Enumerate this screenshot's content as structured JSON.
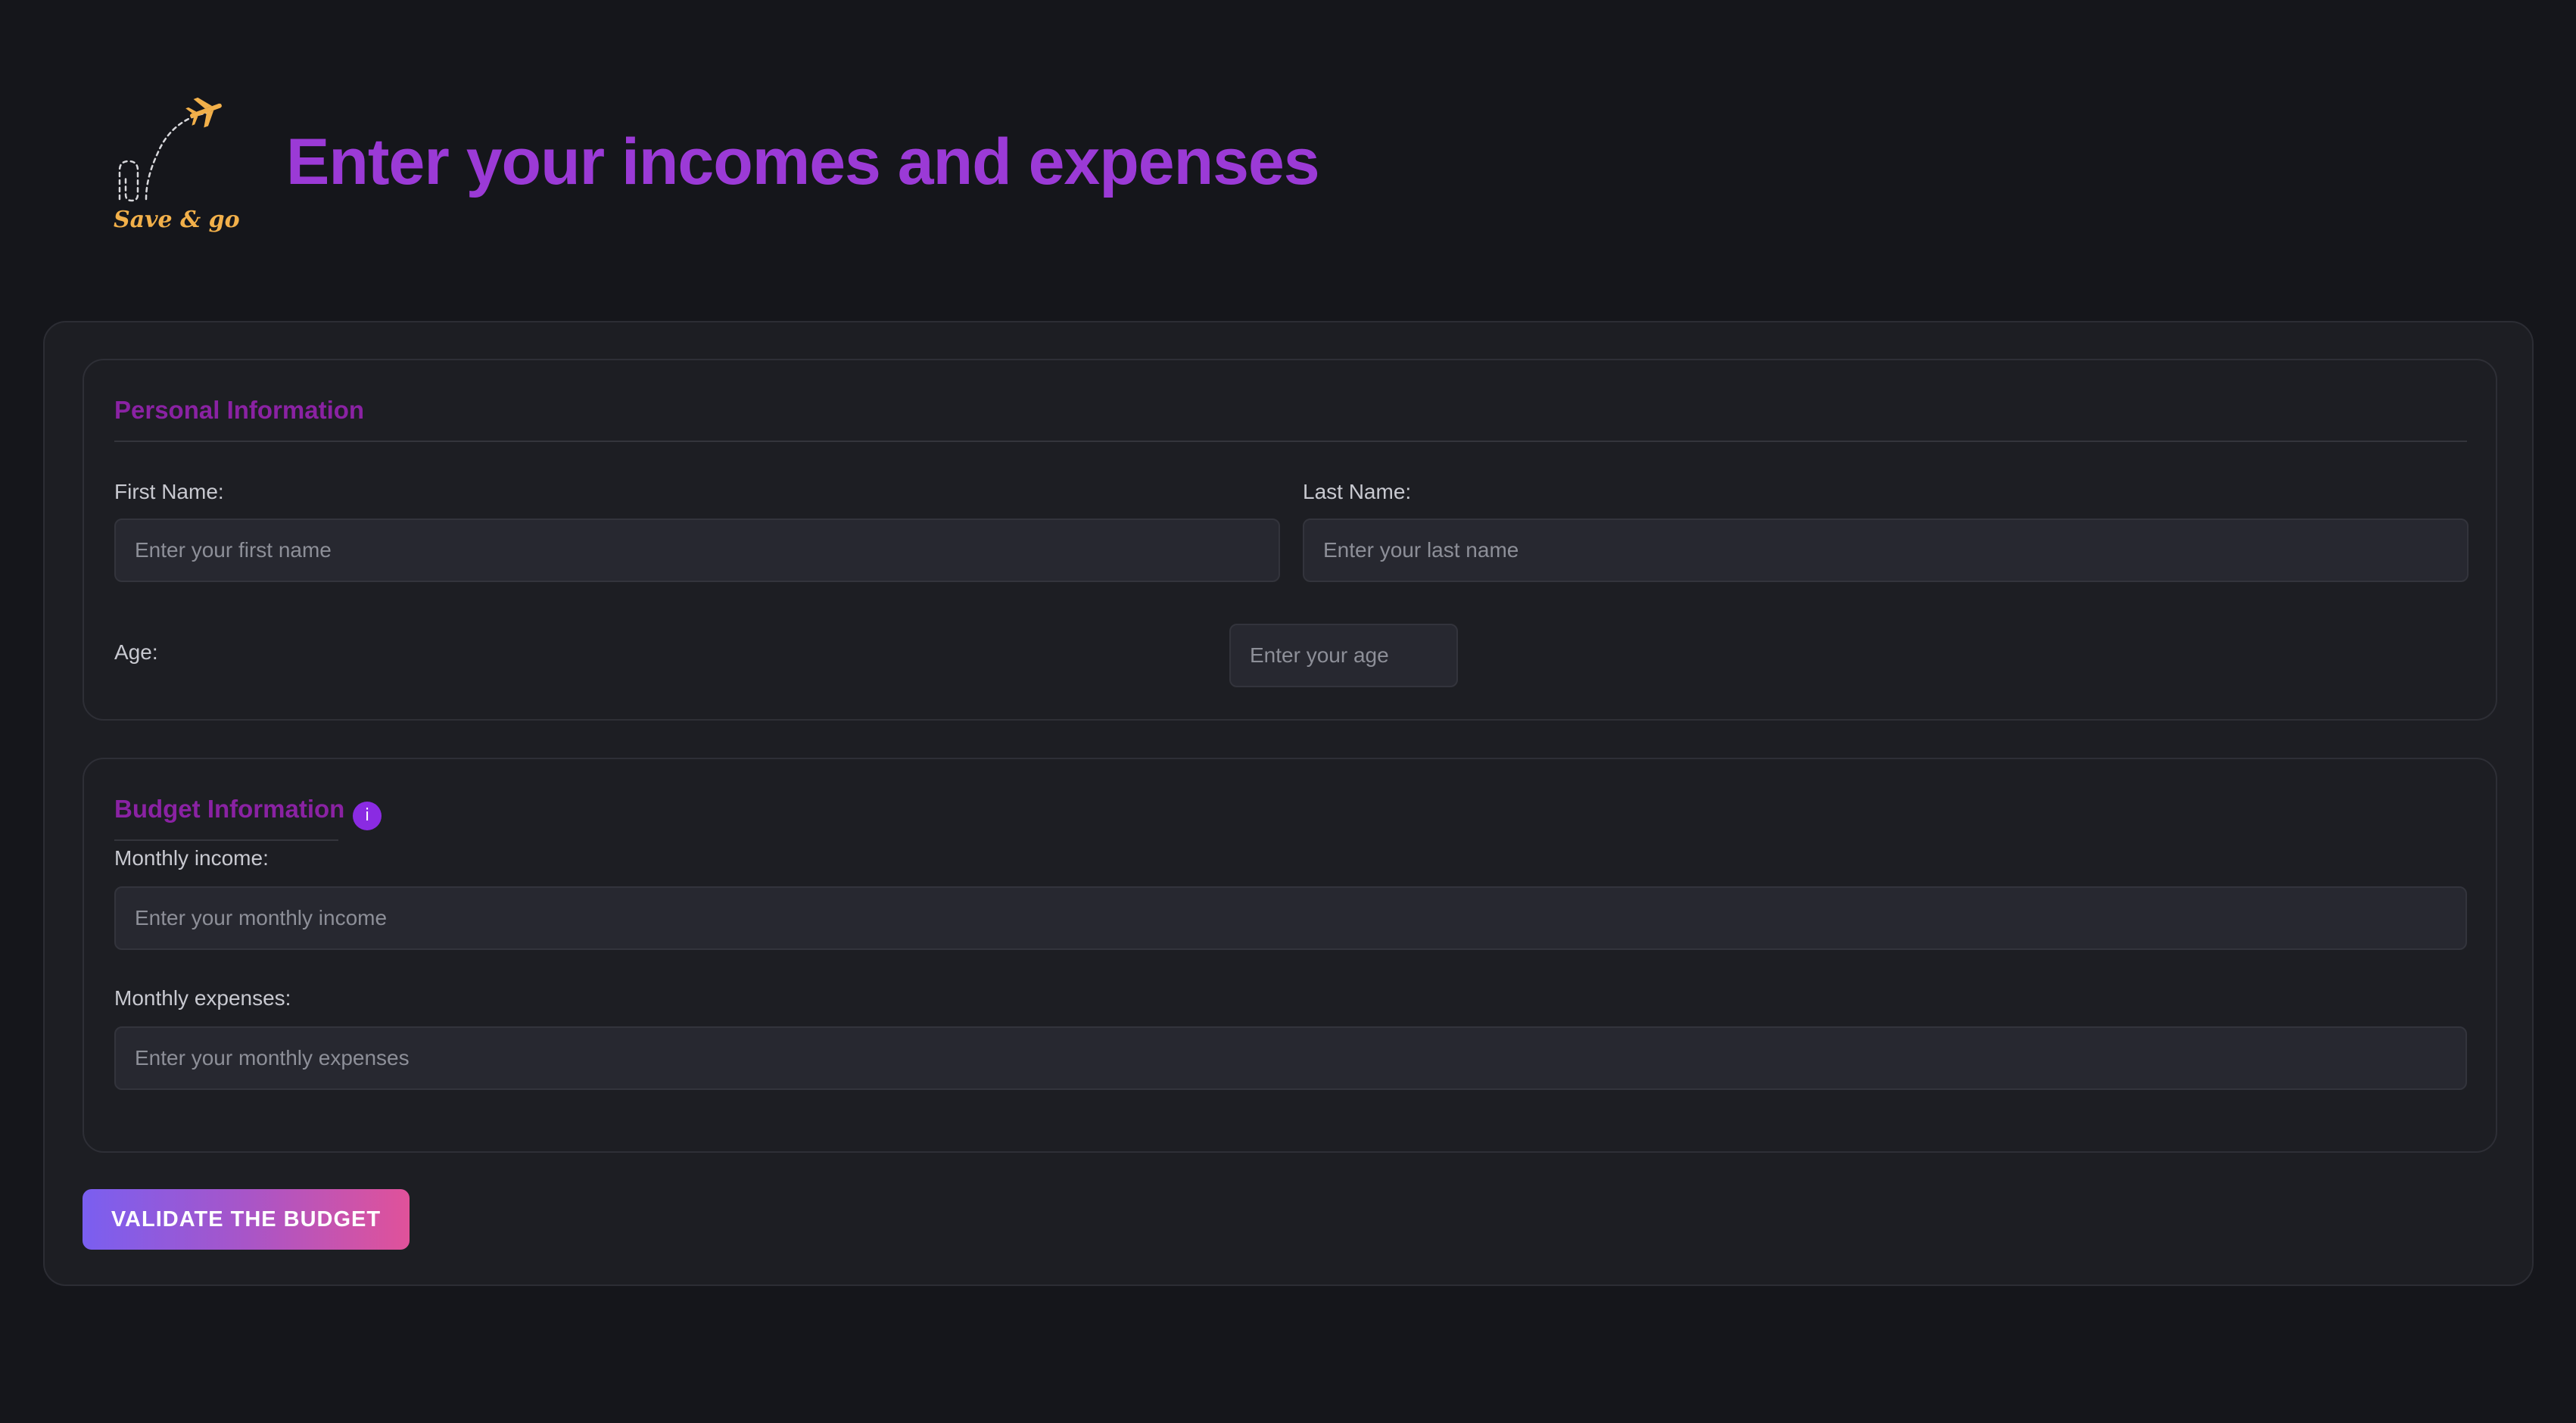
{
  "logo": {
    "text": "Save & go",
    "icon": "airplane-icon",
    "accent": "#f2b04a"
  },
  "page": {
    "title": "Enter your incomes and expenses",
    "title_color": "#9b3ad6"
  },
  "personal": {
    "title": "Personal Information",
    "first_name_label": "First Name:",
    "first_name_placeholder": "Enter your first name",
    "last_name_label": "Last Name:",
    "last_name_placeholder": "Enter your last name",
    "age_label": "Age:",
    "age_placeholder": "Enter your age"
  },
  "budget": {
    "title": "Budget Information",
    "info_icon": "info-icon",
    "info_glyph": "i",
    "income_label": "Monthly income:",
    "income_placeholder": "Enter your monthly income",
    "expenses_label": "Monthly expenses:",
    "expenses_placeholder": "Enter your monthly expenses"
  },
  "actions": {
    "validate_label": "VALIDATE THE BUDGET"
  },
  "colors": {
    "background": "#15161b",
    "section_title": "#8a22a3",
    "button_gradient_start": "#7a5ff0",
    "button_gradient_end": "#e0529a"
  }
}
